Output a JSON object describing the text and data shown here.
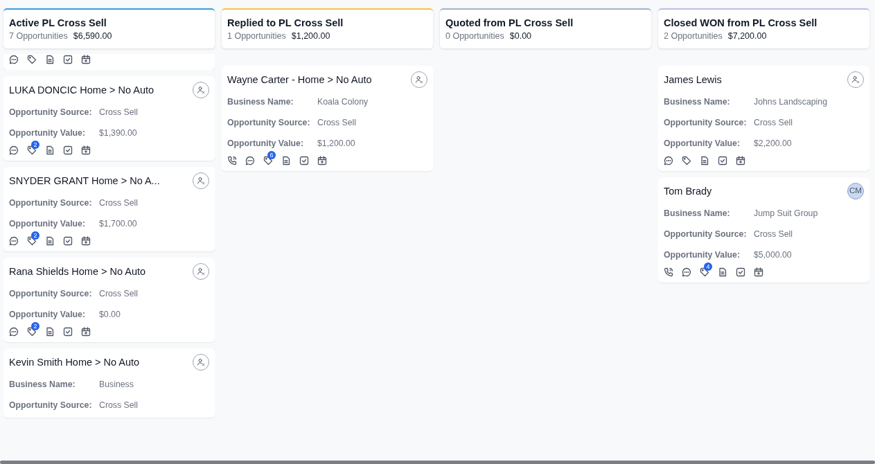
{
  "columns": [
    {
      "title": "Active PL Cross Sell",
      "count": "7 Opportunities",
      "total": "$6,590.00",
      "color": "#3b9ede",
      "cards": [
        {
          "partial": true,
          "icons": [
            {
              "kind": "chat"
            },
            {
              "kind": "tag"
            },
            {
              "kind": "note"
            },
            {
              "kind": "task"
            },
            {
              "kind": "calendar"
            }
          ]
        },
        {
          "title": "LUKA DONCIC Home > No Auto",
          "owner": {
            "kind": "unassigned"
          },
          "fields": [
            {
              "label": "Opportunity Source:",
              "value": "Cross Sell"
            },
            {
              "label": "Opportunity Value:",
              "value": "$1,390.00"
            }
          ],
          "icons": [
            {
              "kind": "chat"
            },
            {
              "kind": "tag",
              "badge": "2"
            },
            {
              "kind": "note"
            },
            {
              "kind": "task"
            },
            {
              "kind": "calendar"
            }
          ]
        },
        {
          "title": "SNYDER GRANT Home > No A...",
          "owner": {
            "kind": "unassigned"
          },
          "fields": [
            {
              "label": "Opportunity Source:",
              "value": "Cross Sell"
            },
            {
              "label": "Opportunity Value:",
              "value": "$1,700.00"
            }
          ],
          "icons": [
            {
              "kind": "chat"
            },
            {
              "kind": "tag",
              "badge": "2"
            },
            {
              "kind": "note"
            },
            {
              "kind": "task"
            },
            {
              "kind": "calendar"
            }
          ]
        },
        {
          "title": "Rana Shields Home > No Auto",
          "owner": {
            "kind": "unassigned"
          },
          "fields": [
            {
              "label": "Opportunity Source:",
              "value": "Cross Sell"
            },
            {
              "label": "Opportunity Value:",
              "value": "$0.00"
            }
          ],
          "icons": [
            {
              "kind": "chat"
            },
            {
              "kind": "tag",
              "badge": "2"
            },
            {
              "kind": "note"
            },
            {
              "kind": "task"
            },
            {
              "kind": "calendar"
            }
          ]
        },
        {
          "title": "Kevin Smith Home > No Auto",
          "owner": {
            "kind": "unassigned"
          },
          "fields": [
            {
              "label": "Business Name:",
              "value": "Business"
            },
            {
              "label": "Opportunity Source:",
              "value": "Cross Sell"
            }
          ]
        }
      ]
    },
    {
      "title": "Replied to PL Cross Sell",
      "count": "1 Opportunities",
      "total": "$1,200.00",
      "color": "#f5c04a",
      "cards": [
        {
          "title": "Wayne Carter - Home > No Auto",
          "owner": {
            "kind": "unassigned"
          },
          "fields": [
            {
              "label": "Business Name:",
              "value": "Koala Colony"
            },
            {
              "label": "Opportunity Source:",
              "value": "Cross Sell"
            },
            {
              "label": "Opportunity Value:",
              "value": "$1,200.00"
            }
          ],
          "icons": [
            {
              "kind": "phone"
            },
            {
              "kind": "chat"
            },
            {
              "kind": "tag",
              "badge": "6"
            },
            {
              "kind": "note"
            },
            {
              "kind": "task"
            },
            {
              "kind": "calendar"
            }
          ]
        }
      ]
    },
    {
      "title": "Quoted from PL Cross Sell",
      "count": "0 Opportunities",
      "total": "$0.00",
      "color": "#a3b1cc"
    },
    {
      "title": "Closed WON from PL Cross Sell",
      "count": "2 Opportunities",
      "total": "$7,200.00",
      "color": "#b9bde8",
      "cards": [
        {
          "title": "James Lewis",
          "owner": {
            "kind": "unassigned"
          },
          "fields": [
            {
              "label": "Business Name:",
              "value": "Johns Landscaping"
            },
            {
              "label": "Opportunity Source:",
              "value": "Cross Sell"
            },
            {
              "label": "Opportunity Value:",
              "value": "$2,200.00"
            }
          ],
          "icons": [
            {
              "kind": "chat"
            },
            {
              "kind": "tag"
            },
            {
              "kind": "note"
            },
            {
              "kind": "task"
            },
            {
              "kind": "calendar"
            }
          ]
        },
        {
          "title": "Tom Brady",
          "owner": {
            "kind": "initials",
            "text": "CM"
          },
          "fields": [
            {
              "label": "Business Name:",
              "value": "Jump Suit Group"
            },
            {
              "label": "Opportunity Source:",
              "value": "Cross Sell"
            },
            {
              "label": "Opportunity Value:",
              "value": "$5,000.00"
            }
          ],
          "icons": [
            {
              "kind": "phone"
            },
            {
              "kind": "chat"
            },
            {
              "kind": "tag",
              "badge": "4"
            },
            {
              "kind": "note"
            },
            {
              "kind": "task"
            },
            {
              "kind": "calendar"
            }
          ]
        }
      ]
    }
  ]
}
